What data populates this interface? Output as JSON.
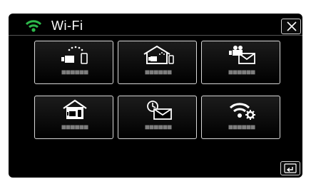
{
  "header": {
    "title": "Wi-Fi",
    "wifi_icon": "wifi-signal-icon",
    "close_icon": "close-x-icon"
  },
  "tiles": [
    {
      "icon": "direct-monitoring-icon",
      "label": "■■■■■■"
    },
    {
      "icon": "indoor-monitoring-icon",
      "label": "■■■■■■"
    },
    {
      "icon": "video-mail-icon",
      "label": "■■■■■■"
    },
    {
      "icon": "home-monitoring-icon",
      "label": "■■■■■■"
    },
    {
      "icon": "scheduled-mail-icon",
      "label": "■■■■■■"
    },
    {
      "icon": "wifi-settings-icon",
      "label": "■■■■■■"
    }
  ],
  "footer": {
    "back_icon": "return-icon"
  },
  "colors": {
    "background": "#000000",
    "wifi_green": "#2db84b",
    "tile_border": "#d8d8d8",
    "label_gray": "#7e7e7e"
  }
}
